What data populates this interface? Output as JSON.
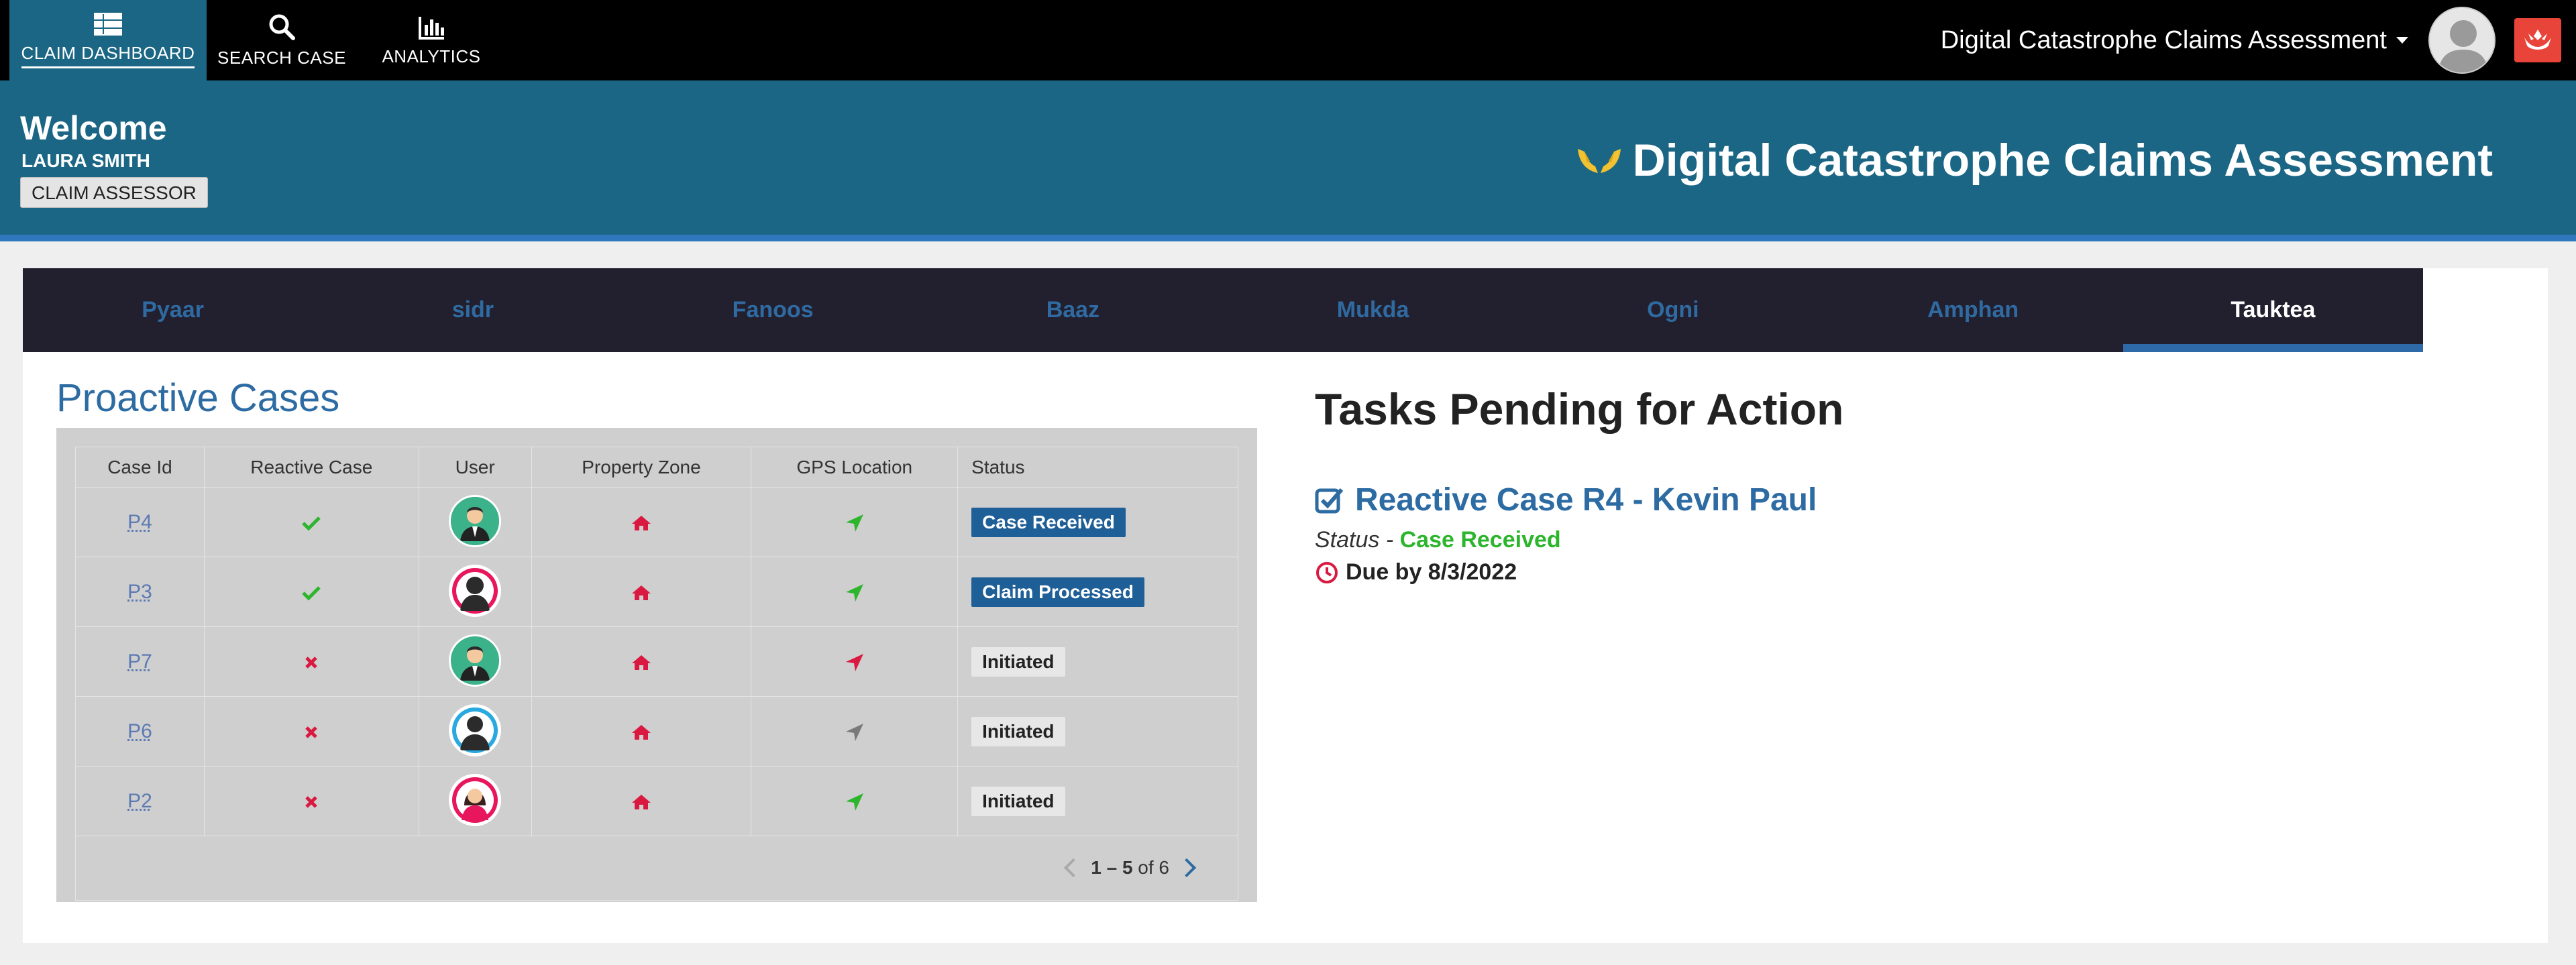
{
  "nav": {
    "items": [
      {
        "label": "CLAIM DASHBOARD",
        "icon": "grid-list-icon",
        "active": true
      },
      {
        "label": "SEARCH CASE",
        "icon": "search-icon",
        "active": false
      },
      {
        "label": "ANALYTICS",
        "icon": "bar-chart-icon",
        "active": false
      }
    ],
    "app_title": "Digital Catastrophe Claims Assessment"
  },
  "header": {
    "welcome": "Welcome",
    "user_name": "LAURA SMITH",
    "role": "CLAIM ASSESSOR",
    "brand_title": "Digital Catastrophe Claims Assessment"
  },
  "tabs": [
    "Pyaar",
    "sidr",
    "Fanoos",
    "Baaz",
    "Mukda",
    "Ogni",
    "Amphan",
    "Tauktea"
  ],
  "active_tab": "Tauktea",
  "proactive": {
    "title": "Proactive Cases",
    "columns": [
      "Case Id",
      "Reactive Case",
      "User",
      "Property Zone",
      "GPS Location",
      "Status"
    ],
    "rows": [
      {
        "id": "P4",
        "reactive": true,
        "user": "male-green",
        "gps": "green",
        "status": "Case Received",
        "badge": "blue"
      },
      {
        "id": "P3",
        "reactive": true,
        "user": "female-dark",
        "gps": "green",
        "status": "Claim Processed",
        "badge": "blue"
      },
      {
        "id": "P7",
        "reactive": false,
        "user": "male-green",
        "gps": "red",
        "status": "Initiated",
        "badge": "gray"
      },
      {
        "id": "P6",
        "reactive": false,
        "user": "male-dark",
        "gps": "gray",
        "status": "Initiated",
        "badge": "gray"
      },
      {
        "id": "P2",
        "reactive": false,
        "user": "female-red",
        "gps": "green",
        "status": "Initiated",
        "badge": "gray"
      }
    ],
    "pager": {
      "range": "1 – 5",
      "of": "of 6"
    }
  },
  "tasks": {
    "title": "Tasks Pending for Action",
    "item_title": "Reactive Case R4 - Kevin Paul",
    "status_label": "Status - ",
    "status_value": "Case Received",
    "due": "Due by 8/3/2022"
  },
  "colors": {
    "topbar": "#000000",
    "header": "#1b6684",
    "accent_blue": "#2d6ba3",
    "tab_bar": "#221f2f",
    "check_green": "#2db52d",
    "danger_red": "#d9193f"
  }
}
